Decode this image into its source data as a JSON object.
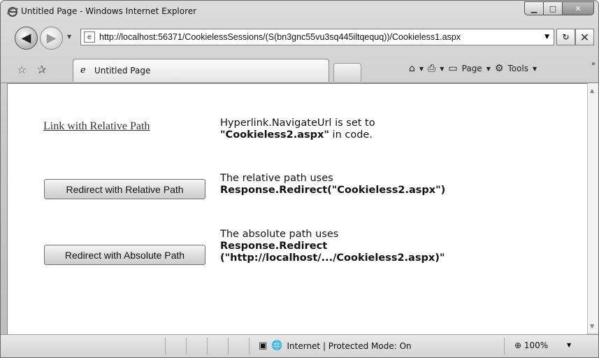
{
  "window": {
    "title": "Untitled Page - Windows Internet Explorer"
  },
  "address": {
    "url": "http://localhost:56371/CookielessSessions/(S(bn3gnc55vu3sq445iltqequq))/Cookieless1.aspx"
  },
  "tab": {
    "label": "Untitled Page"
  },
  "commandbar": {
    "page_label": "Page",
    "tools_label": "Tools"
  },
  "page": {
    "link_label": "Link with Relative Path",
    "link_desc_line1": "Hyperlink.NavigateUrl is set to",
    "link_desc_line2_bold": "\"Cookieless2.aspx\"",
    "link_desc_line2_rest": " in code.",
    "relative_button": "Redirect with Relative Path",
    "relative_desc_line1": "The relative path uses",
    "relative_desc_line2": "Response.Redirect(\"Cookieless2.aspx\")",
    "absolute_button": "Redirect with Absolute Path",
    "absolute_desc_line1": "The absolute path uses",
    "absolute_desc_line2": "Response.Redirect",
    "absolute_desc_line3": "(\"http://localhost/.../Cookieless2.aspx)\""
  },
  "status": {
    "zone": "Internet | Protected Mode: On",
    "zoom": "100%"
  }
}
